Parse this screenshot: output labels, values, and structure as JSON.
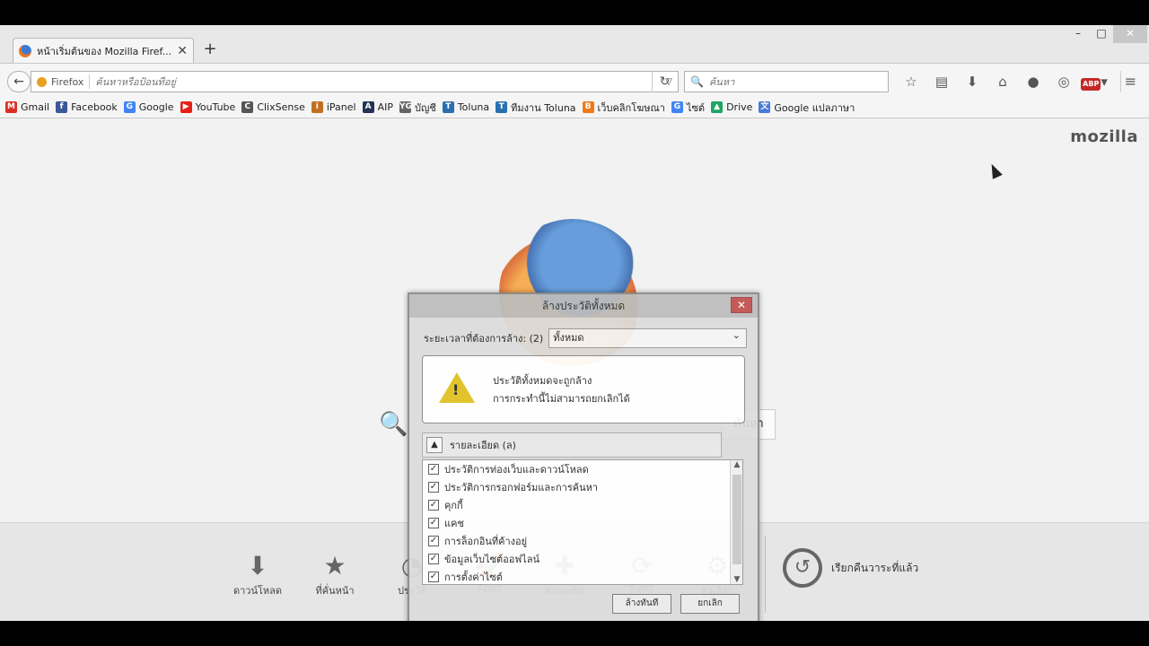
{
  "window": {
    "tab_title": "หน้าเริ่มต้นของ Mozilla Firef...",
    "new_tab": "+",
    "controls": {
      "minimize": "–",
      "maximize": "□",
      "close": "✕"
    }
  },
  "navbar": {
    "back": "←",
    "identity": "Firefox",
    "url_placeholder": "ค้นหาหรือป้อนที่อยู่",
    "reload": "↻",
    "search_placeholder": "ค้นหา",
    "icons": [
      "star-icon",
      "reading-list-icon",
      "download-icon",
      "home-icon",
      "chat-icon",
      "extension-icon",
      "adblock-icon"
    ],
    "adblock": "ABP",
    "menu": "≡"
  },
  "bookmarks": [
    {
      "label": "Gmail",
      "color": "#d93025",
      "glyph": "M"
    },
    {
      "label": "Facebook",
      "color": "#3b5998",
      "glyph": "f"
    },
    {
      "label": "Google",
      "color": "#4285f4",
      "glyph": "G"
    },
    {
      "label": "YouTube",
      "color": "#e62117",
      "glyph": "▶"
    },
    {
      "label": "ClixSense",
      "color": "#555555",
      "glyph": "C"
    },
    {
      "label": "iPanel",
      "color": "#c07020",
      "glyph": "i"
    },
    {
      "label": "AIP",
      "color": "#223355",
      "glyph": "A"
    },
    {
      "label": "บัญชี",
      "color": "#666666",
      "glyph": "YG"
    },
    {
      "label": "Toluna",
      "color": "#2a6fb0",
      "glyph": "T"
    },
    {
      "label": "ทีมงาน Toluna",
      "color": "#2a6fb0",
      "glyph": "T"
    },
    {
      "label": "เว็บคลิกโฆษณา",
      "color": "#f07a1a",
      "glyph": "B"
    },
    {
      "label": "ไซต์",
      "color": "#4285f4",
      "glyph": "G"
    },
    {
      "label": "Drive",
      "color": "#1fa463",
      "glyph": "▲"
    },
    {
      "label": "Google แปลภาษา",
      "color": "#4a7ad8",
      "glyph": "文"
    }
  ],
  "content": {
    "brand": "mozilla",
    "search_button": "ค้นหา",
    "launcher": [
      {
        "label": "ดาวน์โหลด",
        "icon": "download-icon",
        "glyph": "⬇"
      },
      {
        "label": "ที่คั่นหน้า",
        "icon": "bookmarks-icon",
        "glyph": "★"
      },
      {
        "label": "ประวัติ",
        "icon": "history-icon",
        "glyph": "◔"
      },
      {
        "label": "Apps",
        "icon": "apps-icon",
        "glyph": "🚀"
      },
      {
        "label": "ส่วนเสริม",
        "icon": "addons-icon",
        "glyph": "✚"
      },
      {
        "label": "Sync",
        "icon": "sync-icon",
        "glyph": "⟳"
      },
      {
        "label": "ตัวเลือก",
        "icon": "options-icon",
        "glyph": "⚙"
      }
    ],
    "restore": "เรียกคืนวาระที่แล้ว"
  },
  "dialog": {
    "title": "ล้างประวัติทั้งหมด",
    "range_label": "ระยะเวลาที่ต้องการล้าง: (2)",
    "range_value": "ทั้งหมด",
    "warning_line1": "ประวัติทั้งหมดจะถูกล้าง",
    "warning_line2": "การกระทำนี้ไม่สามารถยกเลิกได้",
    "details_label": "รายละเอียด (ล)",
    "items": [
      "ประวัติการท่องเว็บและดาวน์โหลด",
      "ประวัติการกรอกฟอร์มและการค้นหา",
      "คุกกี้",
      "แคช",
      "การล็อกอินที่ค้างอยู่",
      "ข้อมูลเว็บไซต์ออฟไลน์",
      "การตั้งค่าไซต์"
    ],
    "clear_button": "ล้างทันที",
    "cancel_button": "ยกเลิก"
  }
}
